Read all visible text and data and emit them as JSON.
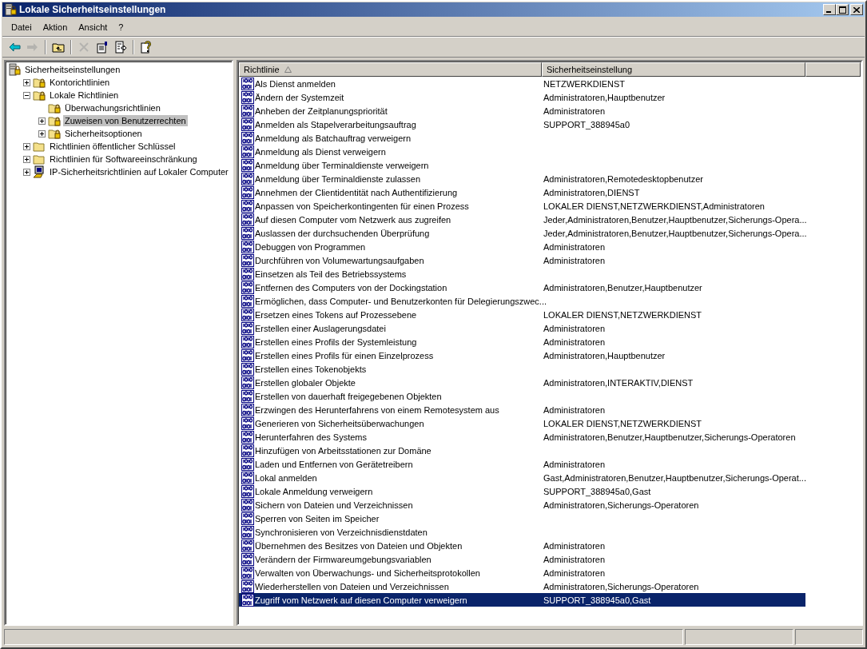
{
  "window": {
    "title": "Lokale Sicherheitseinstellungen"
  },
  "menu": [
    "Datei",
    "Aktion",
    "Ansicht",
    "?"
  ],
  "toolbar": [
    {
      "kind": "back",
      "disabled": false
    },
    {
      "kind": "forward",
      "disabled": true
    },
    {
      "kind": "separator"
    },
    {
      "kind": "up",
      "disabled": false
    },
    {
      "kind": "separator"
    },
    {
      "kind": "delete",
      "disabled": true
    },
    {
      "kind": "properties",
      "disabled": false
    },
    {
      "kind": "export",
      "disabled": false
    },
    {
      "kind": "separator"
    },
    {
      "kind": "help",
      "disabled": false
    }
  ],
  "tree": [
    {
      "label": "Sicherheitseinstellungen",
      "kind": "root",
      "selected": false,
      "children": [
        {
          "label": "Kontorichtlinien",
          "kind": "lockfolder",
          "expanded": false,
          "selected": false
        },
        {
          "label": "Lokale Richtlinien",
          "kind": "lockfolder",
          "expanded": true,
          "selected": false,
          "children": [
            {
              "label": "Überwachungsrichtlinien",
              "kind": "lockfolder",
              "selected": false
            },
            {
              "label": "Zuweisen von Benutzerrechten",
              "kind": "lockfolder",
              "expanded": false,
              "selected": true
            },
            {
              "label": "Sicherheitsoptionen",
              "kind": "lockfolder",
              "expanded": false,
              "selected": false
            }
          ]
        },
        {
          "label": "Richtlinien öffentlicher Schlüssel",
          "kind": "folder",
          "expanded": false,
          "selected": false
        },
        {
          "label": "Richtlinien für Softwareeinschränkung",
          "kind": "folder",
          "expanded": false,
          "selected": false
        },
        {
          "label": "IP-Sicherheitsrichtlinien auf Lokaler Computer",
          "kind": "computer",
          "expanded": false,
          "selected": false
        }
      ]
    }
  ],
  "table": {
    "columns": [
      {
        "label": "Richtlinie",
        "sorted": true
      },
      {
        "label": "Sicherheitseinstellung",
        "sorted": false
      }
    ],
    "rows": [
      {
        "policy": "Als Dienst anmelden",
        "setting": "NETZWERKDIENST",
        "selected": false
      },
      {
        "policy": "Ändern der Systemzeit",
        "setting": "Administratoren,Hauptbenutzer",
        "selected": false
      },
      {
        "policy": "Anheben der Zeitplanungspriorität",
        "setting": "Administratoren",
        "selected": false
      },
      {
        "policy": "Anmelden als Stapelverarbeitungsauftrag",
        "setting": "SUPPORT_388945a0",
        "selected": false
      },
      {
        "policy": "Anmeldung als Batchauftrag verweigern",
        "selected": false
      },
      {
        "policy": "Anmeldung als Dienst verweigern",
        "selected": false
      },
      {
        "policy": "Anmeldung über Terminaldienste verweigern",
        "selected": false
      },
      {
        "policy": "Anmeldung über Terminaldienste zulassen",
        "setting": "Administratoren,Remotedesktopbenutzer",
        "selected": false
      },
      {
        "policy": "Annehmen der Clientidentität nach Authentifizierung",
        "setting": "Administratoren,DIENST",
        "selected": false
      },
      {
        "policy": "Anpassen von Speicherkontingenten für einen Prozess",
        "setting": "LOKALER DIENST,NETZWERKDIENST,Administratoren",
        "selected": false
      },
      {
        "policy": "Auf diesen Computer vom Netzwerk aus zugreifen",
        "setting": "Jeder,Administratoren,Benutzer,Hauptbenutzer,Sicherungs-Opera...",
        "selected": false
      },
      {
        "policy": "Auslassen der durchsuchenden Überprüfung",
        "setting": "Jeder,Administratoren,Benutzer,Hauptbenutzer,Sicherungs-Opera...",
        "selected": false
      },
      {
        "policy": "Debuggen von Programmen",
        "setting": "Administratoren",
        "selected": false
      },
      {
        "policy": "Durchführen von Volumewartungsaufgaben",
        "setting": "Administratoren",
        "selected": false
      },
      {
        "policy": "Einsetzen als Teil des Betriebssystems",
        "selected": false
      },
      {
        "policy": "Entfernen des Computers von der Dockingstation",
        "setting": "Administratoren,Benutzer,Hauptbenutzer",
        "selected": false
      },
      {
        "policy": "Ermöglichen, dass Computer- und Benutzerkonten für Delegierungszwec...",
        "selected": false
      },
      {
        "policy": "Ersetzen eines Tokens auf Prozessebene",
        "setting": "LOKALER DIENST,NETZWERKDIENST",
        "selected": false
      },
      {
        "policy": "Erstellen einer Auslagerungsdatei",
        "setting": "Administratoren",
        "selected": false
      },
      {
        "policy": "Erstellen eines Profils der Systemleistung",
        "setting": "Administratoren",
        "selected": false
      },
      {
        "policy": "Erstellen eines Profils für einen Einzelprozess",
        "setting": "Administratoren,Hauptbenutzer",
        "selected": false
      },
      {
        "policy": "Erstellen eines Tokenobjekts",
        "selected": false
      },
      {
        "policy": "Erstellen globaler Objekte",
        "setting": "Administratoren,INTERAKTIV,DIENST",
        "selected": false
      },
      {
        "policy": "Erstellen von dauerhaft freigegebenen Objekten",
        "selected": false
      },
      {
        "policy": "Erzwingen des Herunterfahrens von einem Remotesystem aus",
        "setting": "Administratoren",
        "selected": false
      },
      {
        "policy": "Generieren von Sicherheitsüberwachungen",
        "setting": "LOKALER DIENST,NETZWERKDIENST",
        "selected": false
      },
      {
        "policy": "Herunterfahren des Systems",
        "setting": "Administratoren,Benutzer,Hauptbenutzer,Sicherungs-Operatoren",
        "selected": false
      },
      {
        "policy": "Hinzufügen von Arbeitsstationen zur Domäne",
        "selected": false
      },
      {
        "policy": "Laden und Entfernen von Gerätetreibern",
        "setting": "Administratoren",
        "selected": false
      },
      {
        "policy": "Lokal anmelden",
        "setting": "Gast,Administratoren,Benutzer,Hauptbenutzer,Sicherungs-Operat...",
        "selected": false
      },
      {
        "policy": "Lokale Anmeldung verweigern",
        "setting": "SUPPORT_388945a0,Gast",
        "selected": false
      },
      {
        "policy": "Sichern von Dateien und Verzeichnissen",
        "setting": "Administratoren,Sicherungs-Operatoren",
        "selected": false
      },
      {
        "policy": "Sperren von Seiten im Speicher",
        "selected": false
      },
      {
        "policy": "Synchronisieren von Verzeichnisdienstdaten",
        "selected": false
      },
      {
        "policy": "Übernehmen des Besitzes von Dateien und Objekten",
        "setting": "Administratoren",
        "selected": false
      },
      {
        "policy": "Verändern der Firmwareumgebungsvariablen",
        "setting": "Administratoren",
        "selected": false
      },
      {
        "policy": "Verwalten von Überwachungs- und Sicherheitsprotokollen",
        "setting": "Administratoren",
        "selected": false
      },
      {
        "policy": "Wiederherstellen von Dateien und Verzeichnissen",
        "setting": "Administratoren,Sicherungs-Operatoren",
        "selected": false
      },
      {
        "policy": "Zugriff vom Netzwerk auf diesen Computer verweigern",
        "setting": "SUPPORT_388945a0,Gast",
        "selected": true
      }
    ]
  }
}
